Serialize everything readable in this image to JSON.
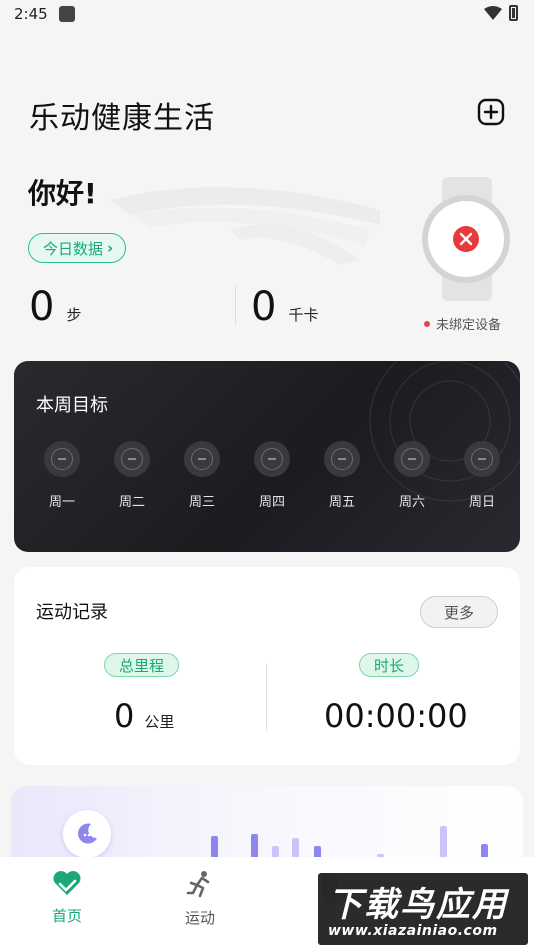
{
  "status_bar": {
    "time": "2:45"
  },
  "header": {
    "app_title": "乐动健康生活",
    "add_icon": "plus-square-icon"
  },
  "today": {
    "greeting": "你好!",
    "chip_label": "今日数据",
    "chip_icon": "chevron-right-icon",
    "steps_value": "0",
    "steps_unit": "步",
    "calories_value": "0",
    "calories_unit": "千卡"
  },
  "device": {
    "status": "未绑定设备",
    "icon": "watch-unbound-icon",
    "status_color": "#e84343"
  },
  "weekly_goal": {
    "title": "本周目标",
    "days": [
      {
        "label": "周一"
      },
      {
        "label": "周二"
      },
      {
        "label": "周三"
      },
      {
        "label": "周四"
      },
      {
        "label": "周五"
      },
      {
        "label": "周六"
      },
      {
        "label": "周日"
      }
    ]
  },
  "exercise_record": {
    "title": "运动记录",
    "more_label": "更多",
    "distance_label": "总里程",
    "distance_value": "0",
    "distance_unit": "公里",
    "duration_label": "时长",
    "duration_value": "00:00:00"
  },
  "sleep": {
    "icon": "moon-icon"
  },
  "bottom_nav": {
    "items": [
      {
        "label": "首页",
        "icon": "heart-icon",
        "active": true
      },
      {
        "label": "运动",
        "icon": "running-icon",
        "active": false
      }
    ]
  },
  "watermark": {
    "text": "下载鸟应用",
    "url": "www.xiazainiao.com"
  },
  "colors": {
    "accent": "#1aa877",
    "card_dark": "#1d1b20",
    "bar_purple": "#8d86ee"
  }
}
